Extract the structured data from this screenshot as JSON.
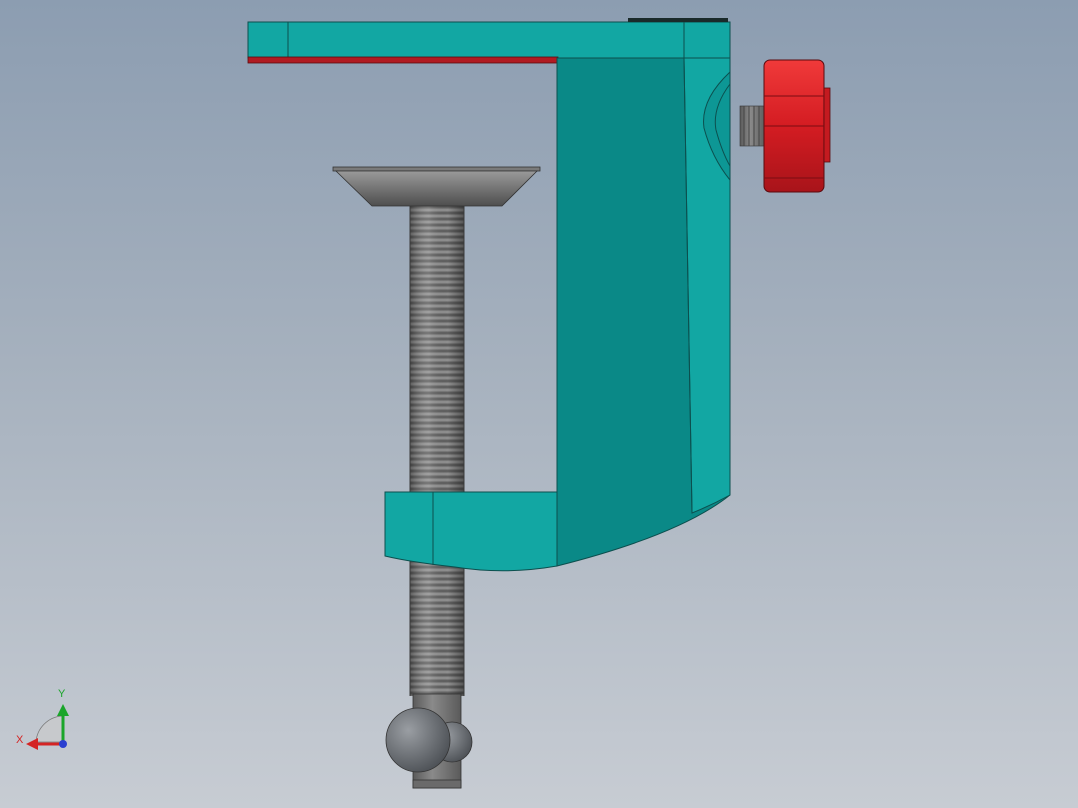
{
  "viewport": {
    "background_top": "#8c9db1",
    "background_bottom": "#c7ccd3"
  },
  "model": {
    "body_color": "#12a7a3",
    "body_dark_color": "#0a8987",
    "knob_color": "#d41c22",
    "pad_strip_color": "#b01b22",
    "screw_color": "#7a7a7a",
    "ball_color": "#6c7074"
  },
  "triad": {
    "x_label": "X",
    "y_label": "Y",
    "x_color": "#d42424",
    "y_color": "#1aa52a",
    "z_color": "#2a3fd0"
  }
}
